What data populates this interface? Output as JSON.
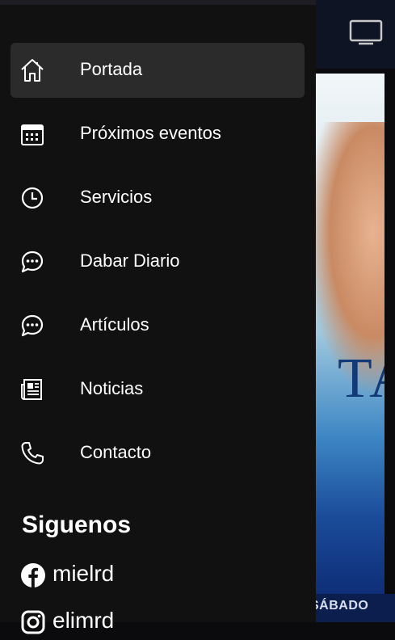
{
  "drawer": {
    "items": [
      {
        "label": "Portada",
        "icon": "home-icon",
        "active": true
      },
      {
        "label": "Próximos eventos",
        "icon": "calendar-icon"
      },
      {
        "label": "Servicios",
        "icon": "clock-icon"
      },
      {
        "label": "Dabar Diario",
        "icon": "chat-bubble-icon"
      },
      {
        "label": "Artículos",
        "icon": "chat-bubble-icon"
      },
      {
        "label": "Noticias",
        "icon": "newspaper-icon"
      },
      {
        "label": "Contacto",
        "icon": "phone-icon"
      }
    ],
    "section_title": "Siguenos",
    "social": [
      {
        "label": "mielrd",
        "icon": "facebook-icon"
      },
      {
        "label": "elimrd",
        "icon": "instagram-icon"
      }
    ]
  },
  "background": {
    "header_icon": "cast-screen-icon",
    "hero_text": "TA",
    "bottom_text": "SÁBADO"
  },
  "colors": {
    "drawer_bg": "#111111",
    "active_item_bg": "#2b2b2b",
    "text": "#ffffff"
  }
}
